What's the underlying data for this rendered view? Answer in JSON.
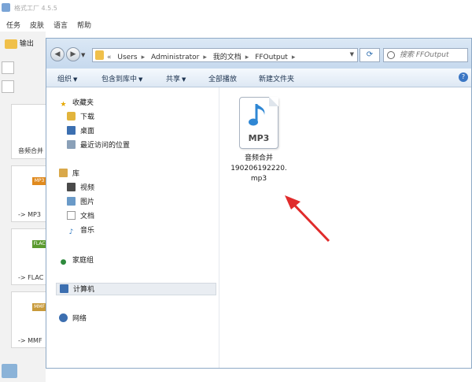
{
  "app": {
    "title": "格式工厂 4.5.5",
    "menu": [
      "任务",
      "皮肤",
      "语言",
      "帮助"
    ],
    "output_button": "输出",
    "cards": [
      {
        "text": "音频合并",
        "tag": ""
      },
      {
        "text": "-> MP3",
        "tag": "MP3"
      },
      {
        "text": "-> FLAC",
        "tag": "FLAC"
      },
      {
        "text": "-> MMF",
        "tag": "MMF"
      }
    ]
  },
  "explorer": {
    "breadcrumb": [
      "«",
      "Users",
      "Administrator",
      "我的文档",
      "FFOutput"
    ],
    "search": {
      "placeholder": "搜索 FFOutput",
      "value": ""
    },
    "toolbar": [
      {
        "label": "组织",
        "dropdown": true
      },
      {
        "label": "包含到库中",
        "dropdown": true
      },
      {
        "label": "共享",
        "dropdown": true
      },
      {
        "label": "全部播放",
        "dropdown": false
      },
      {
        "label": "新建文件夹",
        "dropdown": false
      }
    ],
    "nav": {
      "favorites": {
        "label": "收藏夹",
        "items": [
          "下载",
          "桌面",
          "最近访问的位置"
        ]
      },
      "libraries": {
        "label": "库",
        "items": [
          "视频",
          "图片",
          "文档",
          "音乐"
        ]
      },
      "homegroup": "家庭组",
      "computer": "计算机",
      "network": "网络"
    },
    "file": {
      "icon_label": "MP3",
      "name_lines": [
        "音频合并",
        "190206192220.",
        "mp3"
      ]
    }
  },
  "colors": {
    "accent": "#3a76c4",
    "annotation_arrow": "#e02b2b"
  }
}
